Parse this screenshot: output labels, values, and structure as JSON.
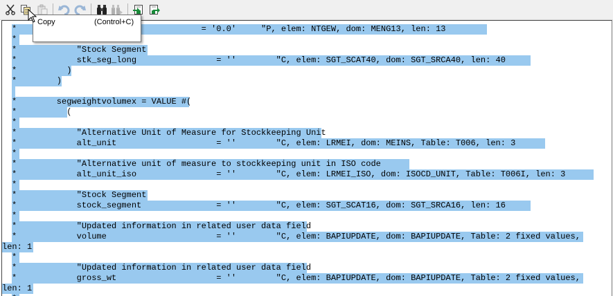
{
  "toolbar": {
    "buttons": [
      {
        "icon": "scissors-icon",
        "name": "cut-button",
        "enabled": true
      },
      {
        "icon": "copy-icon",
        "name": "copy-button",
        "enabled": true
      },
      {
        "icon": "paste-icon",
        "name": "paste-button",
        "enabled": false
      },
      {
        "icon": "undo-icon",
        "name": "undo-button",
        "enabled": false
      },
      {
        "icon": "redo-icon",
        "name": "redo-button",
        "enabled": false
      },
      {
        "icon": "binoculars-icon",
        "name": "find-button",
        "enabled": true
      },
      {
        "icon": "find-next-icon",
        "name": "find-next-button",
        "enabled": false
      },
      {
        "icon": "import-icon",
        "name": "import-button",
        "enabled": true
      },
      {
        "icon": "export-icon",
        "name": "export-button",
        "enabled": true
      }
    ]
  },
  "tooltip": {
    "label": "Copy",
    "shortcut": "(Control+C)"
  },
  "colors": {
    "selection": "#99c9ef",
    "toolbar_bg": "#f0f0f0",
    "icon_blue": "#1f6fc0"
  },
  "editor": {
    "lines": [
      "*                                     = '0.0'     \"P, elem: NTGEW, dom: MENG13, len: 13",
      "*",
      "*            \"Stock Segment",
      "*            stk_seg_long                = ''        \"C, elem: SGT_SCAT40, dom: SGT_SRCA40, len: 40",
      "*          )",
      "*        )",
      "",
      "*        segweightvolumex = VALUE #(",
      "*          (",
      "*",
      "*            \"Alternative Unit of Measure for Stockkeeping Unit",
      "*            alt_unit                    = ''        \"C, elem: LRMEI, dom: MEINS, Table: T006, len: 3",
      "*",
      "*            \"Alternative unit of measure to stockkeeping unit in ISO code",
      "*            alt_unit_iso                = ''        \"C, elem: LRMEI_ISO, dom: ISOCD_UNIT, Table: T006I, len: 3",
      "*",
      "*            \"Stock Segment",
      "*            stock_segment               = ''        \"C, elem: SGT_SCAT16, dom: SGT_SRCA16, len: 16",
      "*",
      "*            \"Updated information in related user data field",
      "*            volume                      = ''        \"C, elem: BAPIUPDATE, dom: BAPIUPDATE, Table: 2 fixed values,",
      "len: 1",
      "*",
      "*            \"Updated information in related user data field",
      "*            gross_wt                    = ''        \"C, elem: BAPIUPDATE, dom: BAPIUPDATE, Table: 2 fixed values,",
      "len: 1",
      "*"
    ]
  }
}
